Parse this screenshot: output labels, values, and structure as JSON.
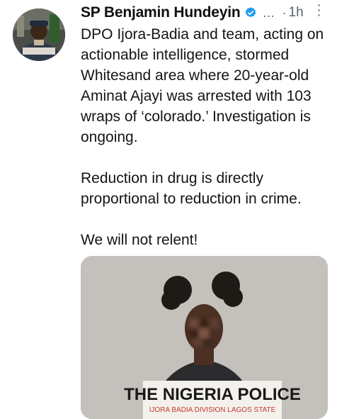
{
  "tweet": {
    "author_name": "SP Benjamin Hundeyin",
    "verified_icon": "verified-badge-icon",
    "overflow_text": "…",
    "separator": "·",
    "time": "1h",
    "more_icon": "vertical-dots-icon",
    "body_lines": [
      "DPO Ijora-Badia and team, acting on",
      "actionable intelligence, stormed",
      "Whitesand area where 20-year-old",
      "Aminat Ajayi was arrested with 103",
      "wraps of ‘colorado.’ Investigation is",
      "ongoing.",
      "Reduction in drug is directly",
      "proportional to reduction in crime.",
      "We will not relent!"
    ],
    "media": {
      "sign_title": "THE NIGERIA POLICE",
      "sign_subtitle": "IJORA BADIA DIVISION LAGOS STATE"
    }
  },
  "colors": {
    "verified": "#1d9bf0",
    "muted_text": "#5b6670",
    "sign_title": "#1a1a1a",
    "sign_subtitle": "#c0392b"
  }
}
